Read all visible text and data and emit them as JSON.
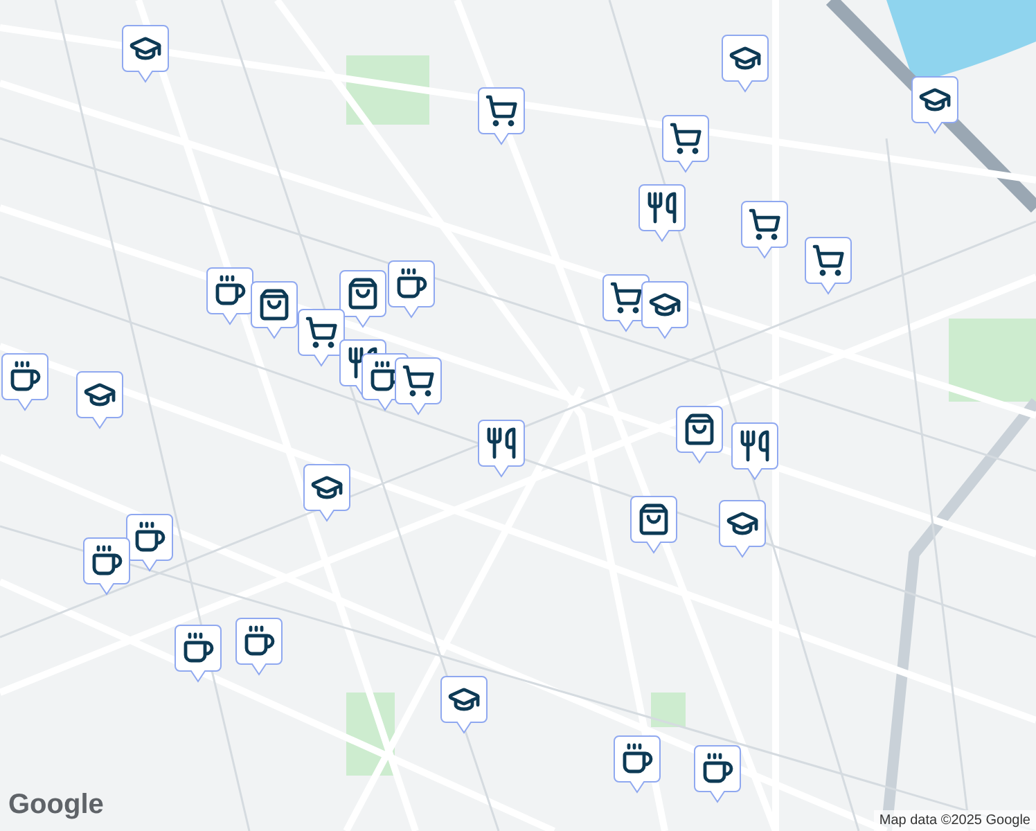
{
  "map": {
    "logo": "Google",
    "attribution": "Map data ©2025 Google"
  },
  "markers": [
    {
      "kind": "school"
    },
    {
      "kind": "cart"
    },
    {
      "kind": "cart"
    },
    {
      "kind": "school"
    },
    {
      "kind": "school"
    },
    {
      "kind": "restaurant"
    },
    {
      "kind": "cart"
    },
    {
      "kind": "cart"
    },
    {
      "kind": "cafe"
    },
    {
      "kind": "shop"
    },
    {
      "kind": "shop"
    },
    {
      "kind": "cafe"
    },
    {
      "kind": "cart"
    },
    {
      "kind": "restaurant"
    },
    {
      "kind": "cafe"
    },
    {
      "kind": "cart"
    },
    {
      "kind": "restaurant"
    },
    {
      "kind": "cart"
    },
    {
      "kind": "school"
    },
    {
      "kind": "shop"
    },
    {
      "kind": "restaurant"
    },
    {
      "kind": "cafe"
    },
    {
      "kind": "school"
    },
    {
      "kind": "school"
    },
    {
      "kind": "shop"
    },
    {
      "kind": "school"
    },
    {
      "kind": "cafe"
    },
    {
      "kind": "cafe"
    },
    {
      "kind": "cafe"
    },
    {
      "kind": "cafe"
    },
    {
      "kind": "school"
    },
    {
      "kind": "cafe"
    },
    {
      "kind": "cafe"
    }
  ]
}
